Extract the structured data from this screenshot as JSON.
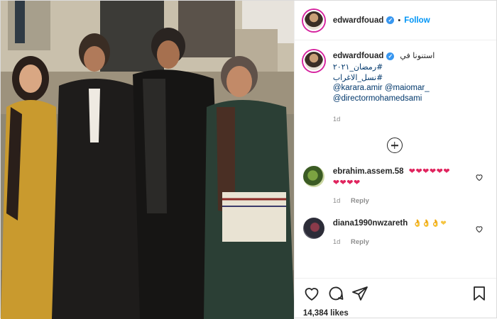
{
  "header": {
    "username": "edwardfouad",
    "verified_mark": "✓",
    "separator": "•",
    "follow_label": "Follow"
  },
  "caption": {
    "username": "edwardfouad",
    "verified_mark": "✓",
    "line1": "استنونا في",
    "line2": "#رمضان_٢٠٢١",
    "line3": "#نسل_الاغراب",
    "line4": "@karara.amir @maiomar_",
    "line5": "@directormohamedsami",
    "time": "1d"
  },
  "comments": [
    {
      "username": "ebrahim.assem.58",
      "text_line1": "❤❤❤❤❤❤",
      "text_line2": "❤❤❤❤",
      "time": "1d",
      "reply_label": "Reply"
    },
    {
      "username": "diana1990nwzareth",
      "text_line1": "👌👌👌❤",
      "time": "1d",
      "reply_label": "Reply"
    }
  ],
  "actions": {
    "like_icon": "heart-icon",
    "comment_icon": "comment-icon",
    "share_icon": "share-icon",
    "save_icon": "bookmark-icon"
  },
  "likes_text": "14,384 likes",
  "colors": {
    "follow_blue": "#0095f6",
    "hashtag": "#00376b",
    "heart_red": "#e0245e",
    "verified": "#3897f0"
  }
}
